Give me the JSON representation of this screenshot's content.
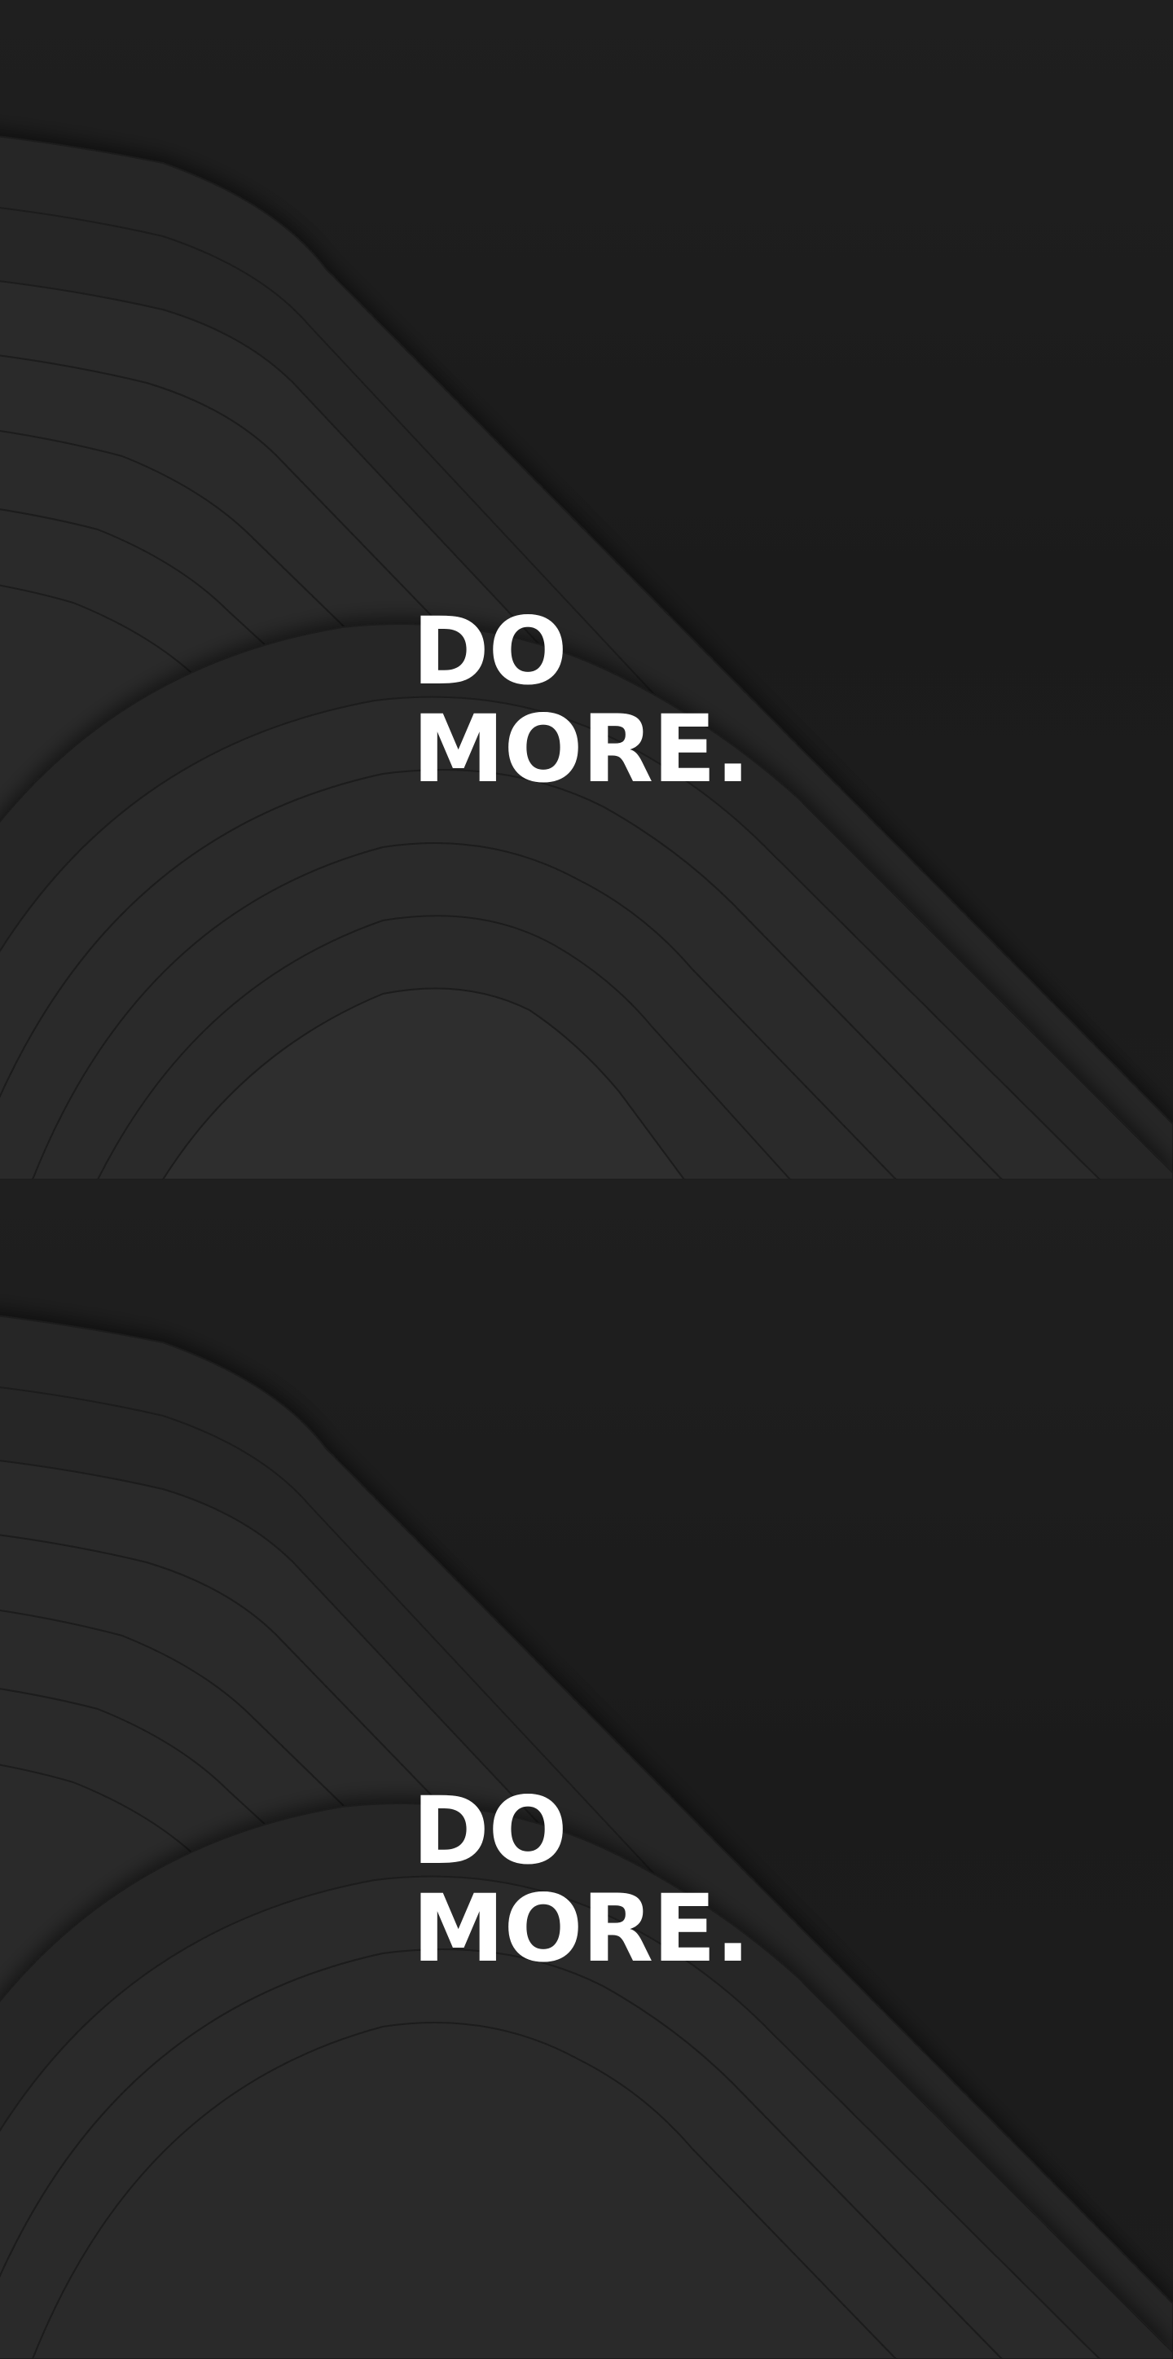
{
  "page": {
    "background_color": "#1c1c1c",
    "wave_fill_color": "#2b2b2b",
    "wave_stroke_color": "#1a1a1a",
    "text_color": "#ffffff"
  },
  "tiles": [
    {
      "headline_line1": "DO",
      "headline_line2": "MORE."
    },
    {
      "headline_line1": "DO",
      "headline_line2": "MORE."
    }
  ]
}
